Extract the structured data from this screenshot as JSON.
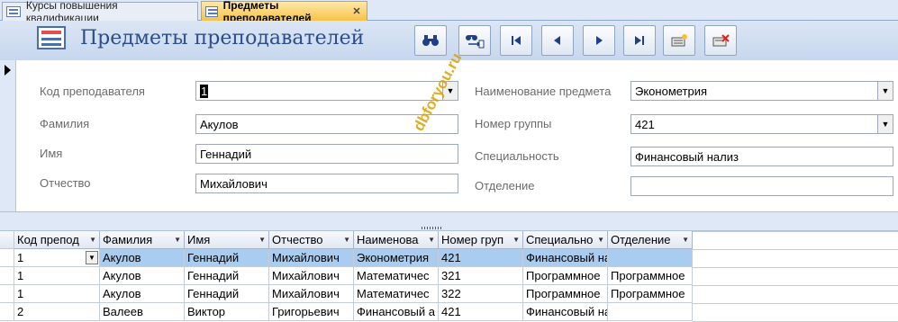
{
  "tabs": [
    {
      "label": "Курсы повышения квалификации",
      "active": false
    },
    {
      "label": "Предметы преподавателей",
      "active": true
    }
  ],
  "header": {
    "title": "Предметы преподавателей",
    "nav_buttons": [
      {
        "name": "find-button",
        "icon": "binoculars"
      },
      {
        "name": "replace-button",
        "icon": "binoculars-replace"
      },
      {
        "name": "first-record-button",
        "icon": "first-record"
      },
      {
        "name": "previous-record-button",
        "icon": "previous-record"
      },
      {
        "name": "next-record-button",
        "icon": "next-record"
      },
      {
        "name": "last-record-button",
        "icon": "last-record"
      },
      {
        "name": "new-record-button",
        "icon": "new-record"
      },
      {
        "name": "delete-record-button",
        "icon": "delete-record"
      }
    ]
  },
  "form": {
    "teacher_code": {
      "label": "Код преподавателя",
      "value": "1"
    },
    "last_name": {
      "label": "Фамилия",
      "value": "Акулов"
    },
    "first_name": {
      "label": "Имя",
      "value": "Геннадий"
    },
    "patronymic": {
      "label": "Отчество",
      "value": "Михайлович"
    },
    "subject_name": {
      "label": "Наименование предмета",
      "value": "Эконометрия"
    },
    "group_number": {
      "label": "Номер группы",
      "value": "421"
    },
    "specialty": {
      "label": "Специальность",
      "value": "Финансовый нализ"
    },
    "department": {
      "label": "Отделение",
      "value": ""
    }
  },
  "watermark": "dbforyou.ru",
  "datasheet": {
    "columns": [
      "Код препод",
      "Фамилия",
      "Имя",
      "Отчество",
      "Наименова",
      "Номер груп",
      "Специально",
      "Отделение"
    ],
    "rows": [
      [
        "1",
        "Акулов",
        "Геннадий",
        "Михайлович",
        "Эконометрия",
        "421",
        "Финансовый на",
        ""
      ],
      [
        "1",
        "Акулов",
        "Геннадий",
        "Михайлович",
        "Математичес",
        "321",
        "Программное",
        "Программное"
      ],
      [
        "1",
        "Акулов",
        "Геннадий",
        "Михайлович",
        "Математичес",
        "322",
        "Программное",
        "Программное"
      ],
      [
        "2",
        "Валеев",
        "Виктор",
        "Григорьевич",
        "Финансовый а",
        "421",
        "Финансовый на",
        ""
      ]
    ]
  },
  "colors": {
    "title": "#2d4d86",
    "header_band": "#c7d7ee",
    "active_tab": "#f6c24a",
    "selected_row": "#a9cdf0",
    "watermark": "#d9a000"
  }
}
